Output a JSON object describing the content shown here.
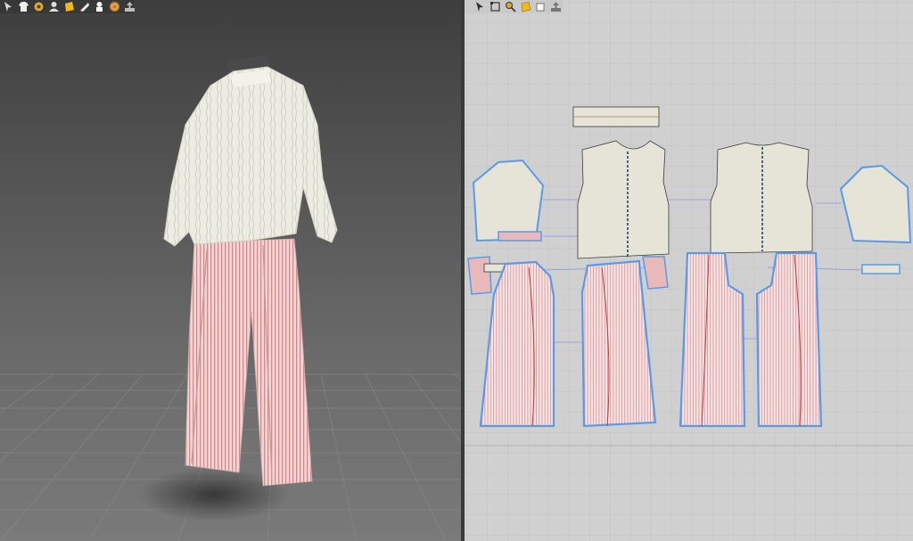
{
  "app": {
    "accent_color": "#4a90d9",
    "fabric_colors": {
      "top": "#ebebdf",
      "pants": "#e9b9b9",
      "pattern_fill": "#e6e3d7",
      "stripe": "#d24a4a",
      "outline_selected": "#5a9ae6"
    }
  },
  "toolbar_3d": {
    "tools": [
      {
        "icon": "select-tool-icon"
      },
      {
        "icon": "shirt-tool-icon"
      },
      {
        "icon": "fold-tool-icon"
      },
      {
        "icon": "avatar-tool-icon"
      },
      {
        "icon": "texture-tool-icon"
      },
      {
        "icon": "pin-tool-icon"
      },
      {
        "icon": "avatar-display-icon"
      },
      {
        "icon": "fabric-ball-icon"
      },
      {
        "icon": "export-icon"
      }
    ]
  },
  "toolbar_2d": {
    "tools": [
      {
        "icon": "transform-tool-icon"
      },
      {
        "icon": "edit-point-icon"
      },
      {
        "icon": "zoom-tool-icon"
      },
      {
        "icon": "texture-tool-icon"
      },
      {
        "icon": "pattern-select-icon"
      },
      {
        "icon": "export-icon"
      }
    ]
  }
}
